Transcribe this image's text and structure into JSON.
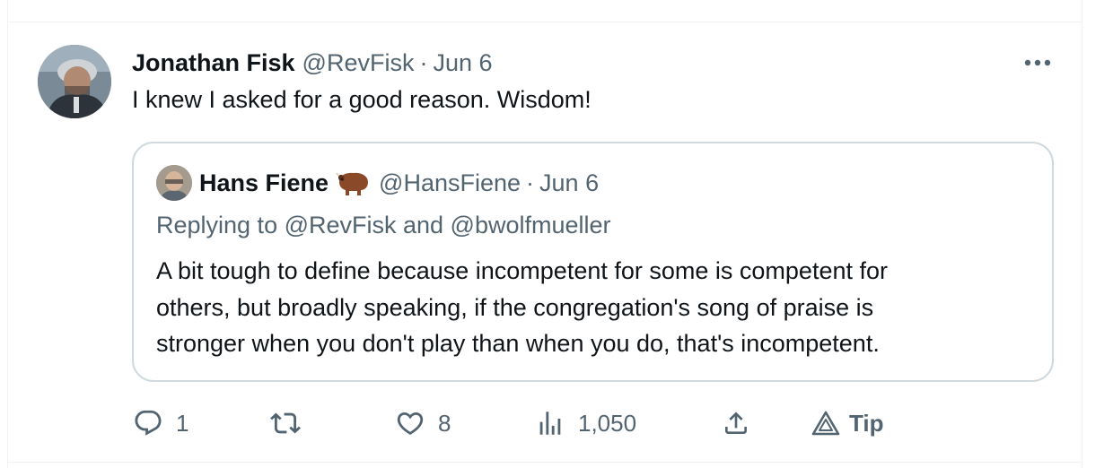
{
  "tweet": {
    "author_name": "Jonathan Fisk",
    "author_handle": "@RevFisk",
    "separator": "·",
    "date": "Jun 6",
    "text": "I knew I asked for a good reason. Wisdom!",
    "more_icon": "more-dots-icon"
  },
  "quote": {
    "author_name": "Hans Fiene",
    "author_emoji": "bison-icon",
    "author_handle": "@HansFiene",
    "separator": "·",
    "date": "Jun 6",
    "replying_to": "Replying to @RevFisk and @bwolfmueller",
    "body_lines": [
      "A bit tough to define because incompetent for some is competent for",
      "others, but broadly speaking, if the congregation's song of praise is",
      "stronger when you don't play than when you do, that's incompetent."
    ]
  },
  "actions": {
    "reply": {
      "icon": "reply-icon",
      "count": "1"
    },
    "retweet": {
      "icon": "retweet-icon",
      "count": ""
    },
    "like": {
      "icon": "heart-icon",
      "count": "8"
    },
    "views": {
      "icon": "views-chart-icon",
      "count": "1,050"
    },
    "share": {
      "icon": "share-icon"
    },
    "tip": {
      "icon": "tip-icon",
      "label": "Tip"
    }
  },
  "colors": {
    "text_primary": "#0f1419",
    "text_secondary": "#536471",
    "border": "#cfd9de",
    "divider": "#eff3f4"
  }
}
